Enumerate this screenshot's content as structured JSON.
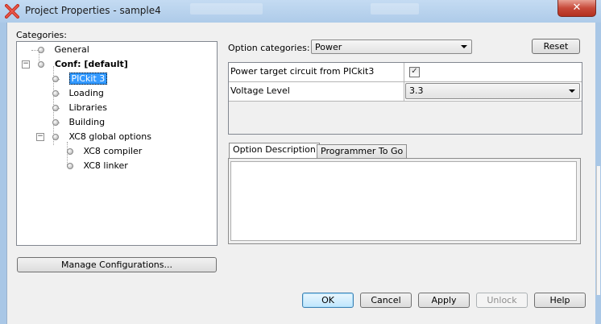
{
  "window": {
    "title": "Project Properties - sample4",
    "close_glyph": "✕"
  },
  "categories": {
    "label": "Categories:",
    "tree": [
      {
        "label": "General"
      },
      {
        "label": "Conf: [default]"
      },
      {
        "label": "PICkit 3",
        "selected": true
      },
      {
        "label": "Loading"
      },
      {
        "label": "Libraries"
      },
      {
        "label": "Building"
      },
      {
        "label": "XC8 global options"
      },
      {
        "label": "XC8 compiler"
      },
      {
        "label": "XC8 linker"
      }
    ],
    "expander_glyph": "−",
    "manage_button": "Manage Configurations..."
  },
  "options": {
    "label": "Option categories:",
    "selected": "Power",
    "reset_button": "Reset",
    "properties": [
      {
        "name": "Power target circuit from PICkit3",
        "checked": true,
        "check_glyph": "✓"
      },
      {
        "name": "Voltage Level",
        "value": "3.3"
      }
    ]
  },
  "description": {
    "tabs": [
      "Option Description",
      "Programmer To Go"
    ],
    "active_tab": "Option Description"
  },
  "buttons": {
    "ok": "OK",
    "cancel": "Cancel",
    "apply": "Apply",
    "unlock": "Unlock",
    "help": "Help"
  },
  "colors": {
    "selection": "#3399ff",
    "default_button_border": "#3c7fb1"
  },
  "icons": {
    "app": "red-x-app-icon",
    "tree_node": "bullet-icon",
    "dropdown": "chevron-down-icon",
    "checkbox": "check-icon"
  }
}
